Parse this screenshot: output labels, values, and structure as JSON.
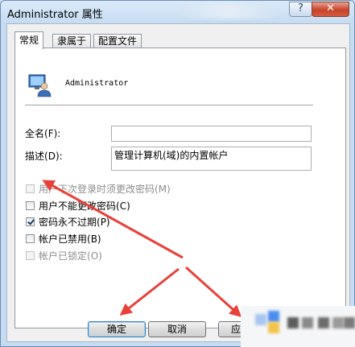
{
  "window": {
    "title": "Administrator 属性",
    "help_label": "?",
    "close_label": "✕"
  },
  "tabs": [
    {
      "label": "常规",
      "active": true
    },
    {
      "label": "隶属于",
      "active": false
    },
    {
      "label": "配置文件",
      "active": false
    }
  ],
  "general": {
    "user_icon": "user-icon",
    "username": "Administrator",
    "full_name_label": "全名",
    "full_name_hotkey": "(F):",
    "full_name_value": "",
    "description_label": "描述",
    "description_hotkey": "(D):",
    "description_value": "管理计算机(域)的内置帐户"
  },
  "checkboxes": [
    {
      "label": "用户下次登录时须更改密码",
      "hotkey": "(M)",
      "checked": false,
      "disabled": true
    },
    {
      "label": "用户不能更改密码",
      "hotkey": "(C)",
      "checked": false,
      "disabled": false
    },
    {
      "label": "密码永不过期",
      "hotkey": "(P)",
      "checked": true,
      "disabled": false
    },
    {
      "label": "帐户已禁用",
      "hotkey": "(B)",
      "checked": false,
      "disabled": false
    },
    {
      "label": "帐户已锁定",
      "hotkey": "(O)",
      "checked": false,
      "disabled": true
    }
  ],
  "buttons": {
    "ok": "确定",
    "cancel": "取消",
    "apply": "应"
  },
  "colors": {
    "annotation_arrow": "#e8413a",
    "titlebar": "#c6dcf2",
    "close_button": "#c7422a"
  }
}
